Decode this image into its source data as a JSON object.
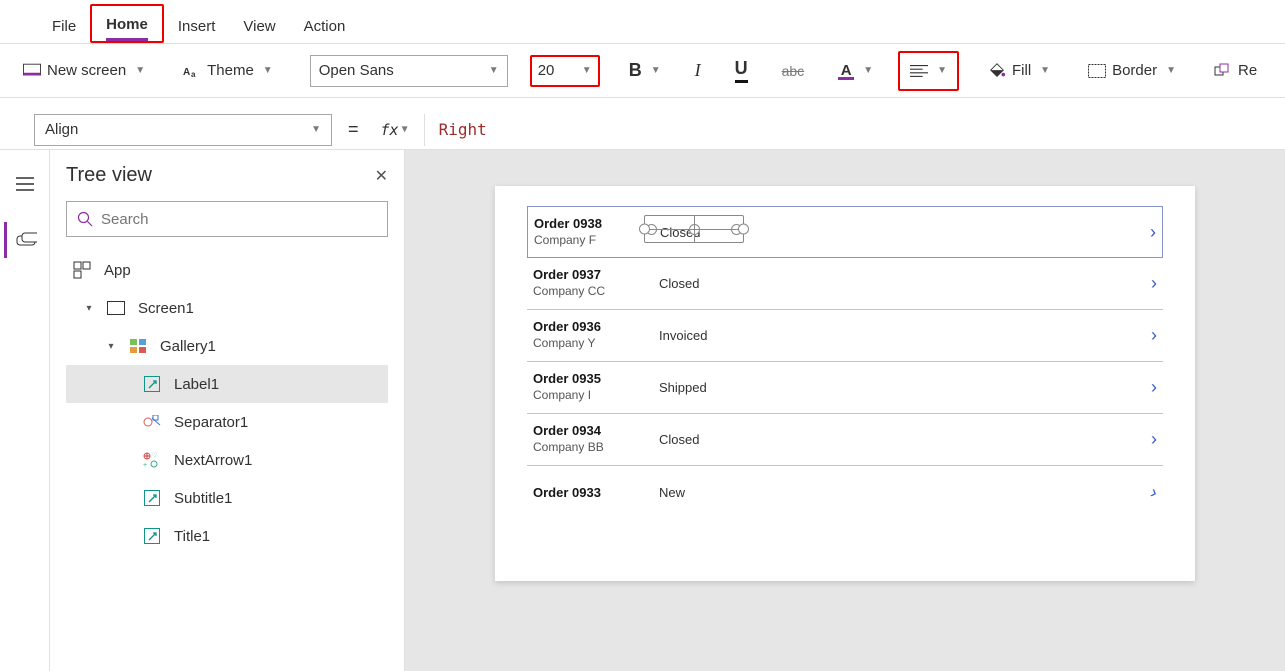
{
  "ribbon": {
    "tabs": [
      "File",
      "Home",
      "Insert",
      "View",
      "Action"
    ],
    "active_tab_index": 1,
    "new_screen": "New screen",
    "theme": "Theme",
    "font_family": "Open Sans",
    "font_size": "20",
    "bold": "B",
    "italic": "I",
    "underline": "U",
    "strike": "abc",
    "font_color_label": "A",
    "fill": "Fill",
    "border": "Border",
    "reorder": "Re"
  },
  "formula": {
    "property": "Align",
    "equals": "=",
    "fx": "fx",
    "value": "Right"
  },
  "tree": {
    "title": "Tree view",
    "search_placeholder": "Search",
    "app": "App",
    "screen": "Screen1",
    "gallery": "Gallery1",
    "items": [
      "Label1",
      "Separator1",
      "NextArrow1",
      "Subtitle1",
      "Title1"
    ],
    "selected_index": 0
  },
  "gallery": {
    "rows": [
      {
        "title": "Order 0938",
        "sub": "Company F",
        "status": "Closed"
      },
      {
        "title": "Order 0937",
        "sub": "Company CC",
        "status": "Closed"
      },
      {
        "title": "Order 0936",
        "sub": "Company Y",
        "status": "Invoiced"
      },
      {
        "title": "Order 0935",
        "sub": "Company I",
        "status": "Shipped"
      },
      {
        "title": "Order 0934",
        "sub": "Company BB",
        "status": "Closed"
      },
      {
        "title": "Order 0933",
        "sub": "",
        "status": "New"
      }
    ]
  }
}
